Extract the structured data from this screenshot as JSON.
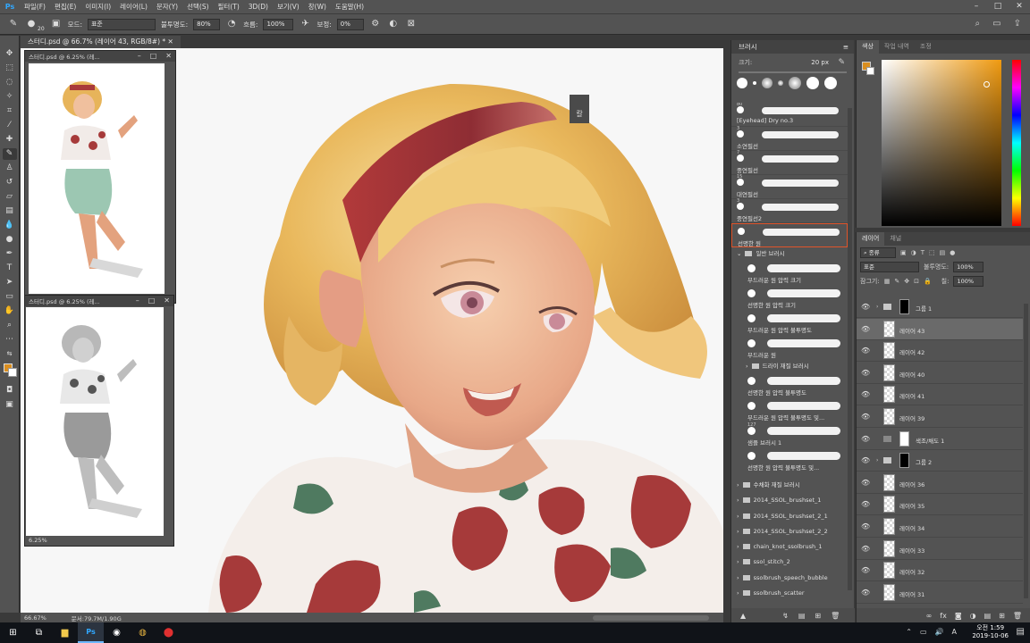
{
  "app": {
    "logo": "Ps",
    "menu": [
      "파일(F)",
      "편집(E)",
      "이미지(I)",
      "레이어(L)",
      "문자(Y)",
      "선택(S)",
      "필터(T)",
      "3D(D)",
      "보기(V)",
      "창(W)",
      "도움말(H)"
    ],
    "window_controls": [
      "–",
      "□",
      "✕"
    ]
  },
  "options": {
    "brush_size": "20",
    "mode_label": "모드:",
    "mode_value": "표준",
    "opacity_label": "불투명도:",
    "opacity_value": "80%",
    "flow_label": "흐름:",
    "flow_value": "100%",
    "smoothing_label": "보정:",
    "smoothing_value": "0%"
  },
  "document": {
    "tab_label": "스터디.psd @ 66.7% (레이어 43, RGB/8#) *",
    "zoom": "66.67%",
    "doc_size": "문서:79.7M/1.90G",
    "float_window_1_title": "스터디.psd @ 6.25% (레...",
    "float_window_2_title": "스터디.psd @ 6.25% (레...",
    "float_window_2_zoom": "6.25%",
    "canvas_text": "칼"
  },
  "brush_panel": {
    "title": "브러시",
    "size_label": "크기:",
    "size_value": "20 px",
    "brushes": [
      {
        "num": "80",
        "name": "[Eyehead] Dry no.3"
      },
      {
        "num": "3",
        "name": "소연필선"
      },
      {
        "num": "7",
        "name": "중연필선"
      },
      {
        "num": "15",
        "name": "대연필선"
      },
      {
        "num": "3",
        "name": "중연필선2"
      },
      {
        "num": "",
        "name": "선명한 원"
      }
    ],
    "group_general": "일반 브러시",
    "general_brushes": [
      "부드러운 원 압력 크기",
      "선명한 원 압력 크기",
      "부드러운 원 압력 불투명도",
      "부드러운 원"
    ],
    "subgroup_dry": "드라이 재질 브러시",
    "more_brushes": [
      {
        "num": "",
        "name": "선명한 원 압력 불투명도"
      },
      {
        "num": "",
        "name": "부드러운 원 압력 불투명도 및..."
      },
      {
        "num": "127",
        "name": "샘플 브러시 1"
      },
      {
        "num": "",
        "name": "선명한 원 압력 불투명도 및..."
      }
    ],
    "folders": [
      "수채화 재질 브러시",
      "2014_SSOL_brushset_1",
      "2014_SSOL_brushset_2_1",
      "2014_SSOL_brushset_2_2",
      "chain_knot_ssolbrush_1",
      "ssol_stitch_2",
      "ssolbrush_speech_bubble",
      "ssolbrush_scatter"
    ]
  },
  "color_panel": {
    "tabs": [
      "색상",
      "작업 내역",
      "조정"
    ],
    "foreground": "#d98e20"
  },
  "layers_panel": {
    "tabs": [
      "레이어",
      "채널"
    ],
    "kind_label": "종류",
    "blend_mode": "표준",
    "opacity_label": "불투명도:",
    "opacity_value": "100%",
    "lock_label": "잠그기:",
    "fill_label": "칠:",
    "fill_value": "100%",
    "layers": [
      {
        "name": "그룹 1",
        "type": "group"
      },
      {
        "name": "레이어 43",
        "type": "layer",
        "active": true
      },
      {
        "name": "레이어 42",
        "type": "layer"
      },
      {
        "name": "레이어 40",
        "type": "layer"
      },
      {
        "name": "레이어 41",
        "type": "layer"
      },
      {
        "name": "레이어 39",
        "type": "layer"
      },
      {
        "name": "색조/채도 1",
        "type": "adjustment"
      },
      {
        "name": "그룹 2",
        "type": "group"
      },
      {
        "name": "레이어 36",
        "type": "layer"
      },
      {
        "name": "레이어 35",
        "type": "layer"
      },
      {
        "name": "레이어 34",
        "type": "layer"
      },
      {
        "name": "레이어 33",
        "type": "layer"
      },
      {
        "name": "레이어 32",
        "type": "layer"
      },
      {
        "name": "레이어 31",
        "type": "layer"
      }
    ]
  },
  "taskbar": {
    "time_label": "오전 1:59",
    "date": "2019-10-06",
    "ime": "A"
  }
}
